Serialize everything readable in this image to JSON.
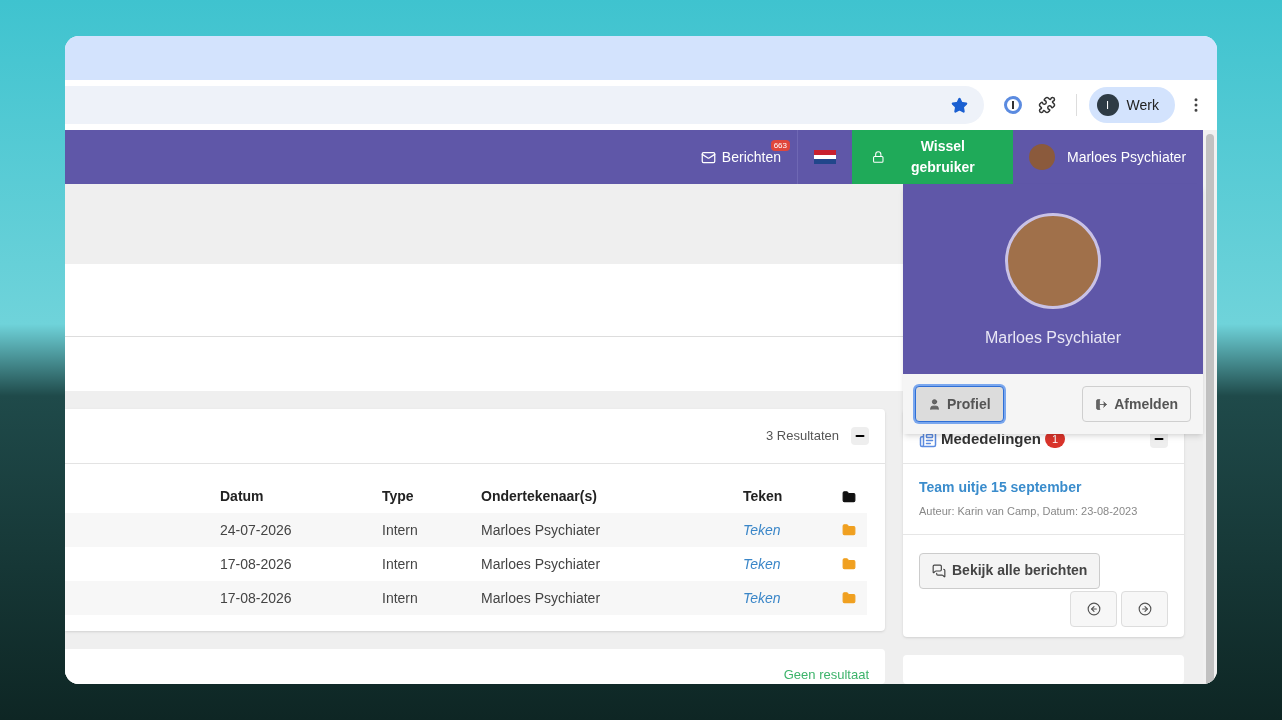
{
  "browser": {
    "profile_initial": "I",
    "profile_name": "Werk"
  },
  "navbar": {
    "messages": {
      "label": "Berichten",
      "count": "663"
    },
    "switch_user": "Wissel gebruiker",
    "user_name": "Marloes Psychiater"
  },
  "profile_menu": {
    "name": "Marloes Psychiater",
    "buttons": [
      {
        "label": "Profiel",
        "kind": "profile",
        "focused": true
      },
      {
        "label": "Afmelden",
        "kind": "logout",
        "focused": false
      }
    ]
  },
  "documents": {
    "count": "3 Resultaten",
    "columns": [
      "Datum",
      "Type",
      "Ondertekenaar(s)",
      "Teken"
    ],
    "rows": [
      {
        "date": "24-07-2026",
        "type": "Intern",
        "signer": "Marloes Psychiater",
        "action": "Teken"
      },
      {
        "date": "17-08-2026",
        "type": "Intern",
        "signer": "Marloes Psychiater",
        "action": "Teken"
      },
      {
        "date": "17-08-2026",
        "type": "Intern",
        "signer": "Marloes Psychiater",
        "action": "Teken"
      }
    ]
  },
  "second_panel": {
    "status": "Geen resultaat"
  },
  "announcements": {
    "title": "Mededelingen",
    "count": "1",
    "items": [
      {
        "title": "Team uitje 15 september",
        "meta": "Auteur: Karin van Camp, Datum: 23-08-2023"
      }
    ],
    "view_all": "Bekijk alle berichten"
  }
}
